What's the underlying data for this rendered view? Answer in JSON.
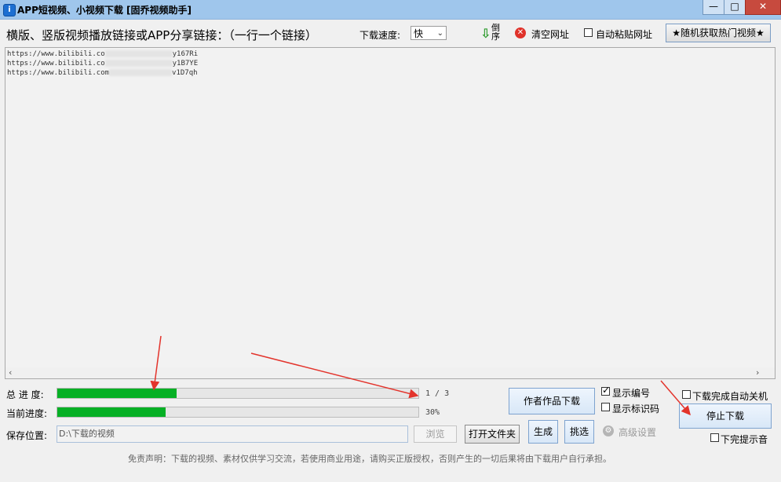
{
  "window": {
    "title": "APP短视频、小视频下载 [固乔视频助手]",
    "icon": "app-icon",
    "min_label": "—",
    "max_label": "□",
    "close_label": "✕"
  },
  "toolbar": {
    "header_label": "横版、竖版视频播放链接或APP分享链接：（一行一个链接）",
    "speed_label": "下载速度:",
    "speed_value": "快",
    "reverse_label": "倒序",
    "clear_label": "清空网址",
    "auto_paste_label": "自动粘贴网址",
    "auto_paste_checked": false,
    "hot_videos_label": "★随机获取热门视频★"
  },
  "urls": [
    {
      "prefix": "https://www.bilibili.co",
      "suffix": "y167Ri"
    },
    {
      "prefix": "https://www.bilibili.co",
      "suffix": "y1B7YE"
    },
    {
      "prefix": "https://www.bilibili.com",
      "suffix": "v1D7qh"
    }
  ],
  "progress": {
    "total_label": "总 进 度:",
    "total_text": "1 / 3",
    "total_fraction": 0.33,
    "current_label": "当前进度:",
    "current_text": "30%",
    "current_fraction": 0.3
  },
  "save": {
    "label": "保存位置:",
    "path": "D:\\下载的视频",
    "browse_label": "浏览",
    "open_folder_label": "打开文件夹"
  },
  "actions": {
    "author_works_label": "作者作品下载",
    "generate_label": "生成",
    "pick_label": "挑选",
    "show_number_label": "显示编号",
    "show_number_checked": true,
    "show_id_label": "显示标识码",
    "show_id_checked": false,
    "advanced_label": "高级设置",
    "shutdown_label": "下载完成自动关机",
    "shutdown_checked": false,
    "stop_label": "停止下载",
    "notify_label": "下完提示音",
    "notify_checked": false
  },
  "disclaimer": "免责声明：下载的视频、素材仅供学习交流，若使用商业用途，请购买正版授权，否则产生的一切后果将由下载用户自行承担。",
  "colors": {
    "progress_fill": "#06b025",
    "annotation_arrow": "#e3342c",
    "titlebar": "#9fc6ec"
  }
}
